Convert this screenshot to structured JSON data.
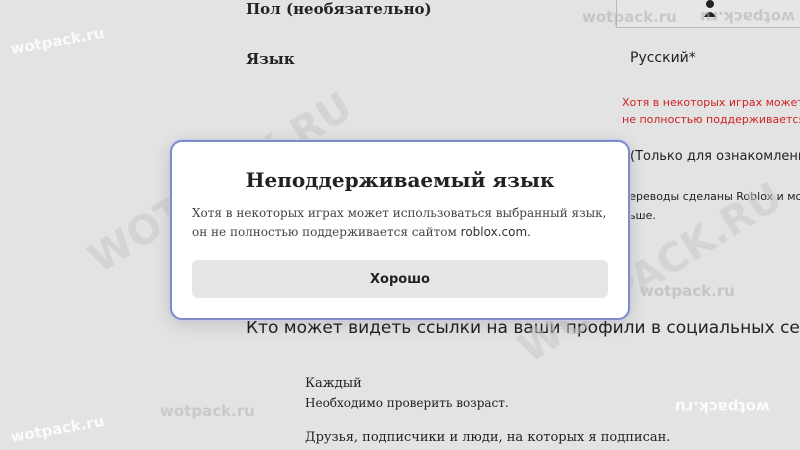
{
  "form": {
    "gender_label": "Пол (необязательно)",
    "language_label": "Язык",
    "language_value": "Русский*",
    "warning_line1": "Хотя в некоторых играх может исп",
    "warning_line2": "не полностью поддерживается сай",
    "readonly_note": "(Только для ознакомления)",
    "translation_line1": "переводы сделаны Roblox и мог",
    "translation_line2": "льше.",
    "social_question": "Кто может видеть ссылки на ваши профили в социальных сетях?",
    "option1_title": "Каждый",
    "option1_note": "Необходимо проверить возраст.",
    "option2_title": "Друзья, подписчики и люди, на которых я подписан."
  },
  "modal": {
    "title": "Неподдерживаемый язык",
    "body_text": "Хотя в некоторых играх может использоваться выбранный язык, он не полностью поддерживается сайтом",
    "body_site": "roblox.com.",
    "ok_label": "Хорошо"
  },
  "watermarks": {
    "small": "wotpack.ru",
    "mirrored": "wotpack.ru",
    "big": "WOTPACK.RU"
  },
  "icons": {
    "user": "user-icon"
  }
}
